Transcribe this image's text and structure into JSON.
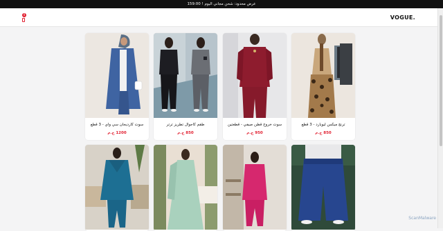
{
  "promo": {
    "text": "عرض محدود: شحن مجاني اليوم ! 159:00"
  },
  "header": {
    "logo": "VOGUE.",
    "cart_count": "0"
  },
  "products": [
    {
      "title": "ترنج ميكس ليوبارد - 3 قطع",
      "price": "850 ج.م"
    },
    {
      "title": "سوت خروج قطن صيفي - قطعتين",
      "price": "950 ج.م"
    },
    {
      "title": "طقم كاجوال تطريز ترتر",
      "price": "850 ج.م"
    },
    {
      "title": "سوت كارديجان سي واي - 3 قطع",
      "price": "1200 ج.م"
    }
  ],
  "watermark": "ScanMalware"
}
